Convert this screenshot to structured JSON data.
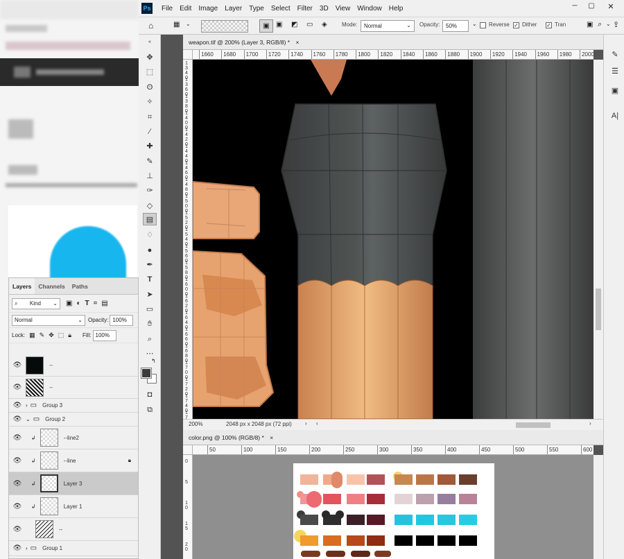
{
  "menubar": {
    "app_icon": "Ps",
    "items": [
      "File",
      "Edit",
      "Image",
      "Layer",
      "Type",
      "Select",
      "Filter",
      "3D",
      "View",
      "Window",
      "Help"
    ]
  },
  "options": {
    "mode_label": "Mode:",
    "mode_value": "Normal",
    "opacity_label": "Opacity:",
    "opacity_value": "50%",
    "reverse_label": "Reverse",
    "dither_label": "Dither",
    "transparency_label": "Tran"
  },
  "doc1": {
    "tab_title": "weapon.tif @ 200% (Layer 3, RGB/8) *",
    "ruler_ticks": [
      "1660",
      "1680",
      "1700",
      "1720",
      "1740",
      "1760",
      "1780",
      "1800",
      "1820",
      "1840",
      "1860",
      "1880",
      "1900",
      "1920",
      "1940",
      "1960",
      "1980",
      "2000"
    ],
    "vruler_ticks": [
      "1340",
      "1360",
      "1380",
      "1400",
      "1420",
      "1440",
      "1460",
      "1480",
      "1500",
      "1520",
      "1540",
      "1560",
      "1580",
      "1600",
      "1620",
      "1640",
      "1660",
      "1680",
      "1700",
      "1720",
      "1740",
      "1760"
    ],
    "zoom": "200%",
    "doc_info": "2048 px x 2048 px (72 ppi)"
  },
  "doc2": {
    "tab_title": "color.png @ 100% (RGB/8) *",
    "ruler_ticks": [
      "50",
      "100",
      "150",
      "200",
      "250",
      "300",
      "350",
      "400",
      "450",
      "500",
      "550",
      "600"
    ],
    "vruler_ticks": [
      "0",
      "5",
      "10",
      "15",
      "20"
    ]
  },
  "layers": {
    "tabs": [
      "Layers",
      "Channels",
      "Paths"
    ],
    "filter_kind": "Kind",
    "blend_mode": "Normal",
    "opacity_label": "Opacity:",
    "opacity_value": "100%",
    "lock_label": "Lock:",
    "fill_label": "Fill:",
    "fill_value": "100%",
    "items": [
      {
        "name": "--"
      },
      {
        "name": "--"
      },
      {
        "name": "Group 3"
      },
      {
        "name": "Group 2"
      },
      {
        "name": "--line2"
      },
      {
        "name": "--line"
      },
      {
        "name": "Layer 3"
      },
      {
        "name": "Layer 1"
      },
      {
        "name": "--"
      },
      {
        "name": "Group 1"
      }
    ]
  },
  "colors": {
    "accent": "#31a8ff",
    "panel": "#f0f0f0",
    "canvas_bg": "#535353"
  }
}
